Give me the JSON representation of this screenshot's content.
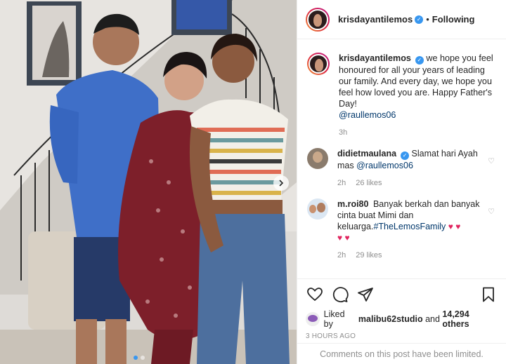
{
  "header": {
    "username": "krisdayantilemos",
    "separator": "•",
    "follow_state": "Following"
  },
  "caption": {
    "username": "krisdayantilemos",
    "text": "we hope you feel honoured for all your years of leading our family. And every day, we hope you feel how loved you are. Happy Father's Day!",
    "mention": "@raullemos06",
    "time": "3h"
  },
  "comments": [
    {
      "username": "didietmaulana",
      "verified": true,
      "text": "Slamat hari Ayah mas",
      "mention": "@raullemos06",
      "time": "2h",
      "likes": "26 likes"
    },
    {
      "username": "m.roi80",
      "verified": false,
      "text": "Banyak berkah dan banyak cinta buat Mimi dan keluarga.",
      "hashtag": "#TheLemosFamily",
      "hearts": "♥ ♥",
      "hearts2": "♥ ♥",
      "time": "2h",
      "likes": "29 likes"
    }
  ],
  "likes": {
    "prefix": "Liked by",
    "liker": "malibu62studio",
    "joiner": "and",
    "others": "14,294 others"
  },
  "posted_time": "3 HOURS AGO",
  "comments_notice": "Comments on this post have been limited.",
  "icons": [
    "verified-badge-icon",
    "heart-icon",
    "comment-icon",
    "share-icon",
    "bookmark-icon",
    "chevron-right-icon"
  ],
  "colors": {
    "verified": "#3897f0",
    "heart": "#e0245e",
    "link": "#00376b",
    "muted": "#8e8e8e"
  }
}
